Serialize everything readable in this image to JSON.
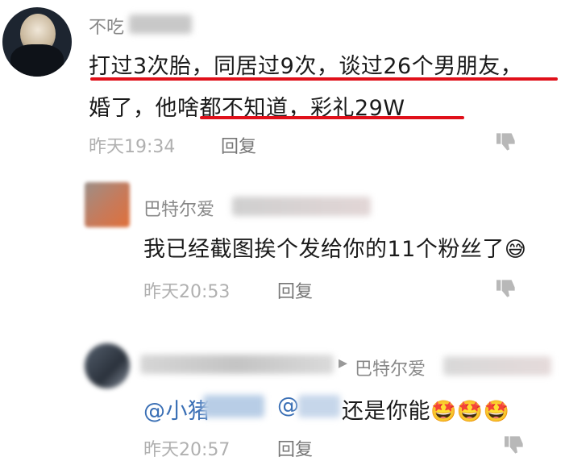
{
  "comments": [
    {
      "username": "不吃",
      "line1": "打过3次胎，同居过9次，谈过26个男朋友，",
      "line2": "婚了，他啥都不知道，彩礼29W",
      "time": "昨天19:34",
      "reply_label": "回复"
    },
    {
      "username": "巴特尔爱",
      "text": "我已经截图挨个发给你的11个粉丝了",
      "emoji": "😅",
      "time": "昨天20:53",
      "reply_label": "回复"
    },
    {
      "reply_to_prefix": "▸",
      "username": "巴特尔爱",
      "mention1": "@小猪",
      "mention1_tail": "",
      "mention2": "@",
      "text": "还是你能",
      "emojis": "🤩🤩🤩",
      "time": "昨天20:57",
      "reply_label": "回复"
    }
  ],
  "icons": {
    "dislike": "thumbs-down-icon"
  },
  "colors": {
    "underline": "#e0101a",
    "mention": "#3a6fb5",
    "meta": "#b0b0b0"
  }
}
